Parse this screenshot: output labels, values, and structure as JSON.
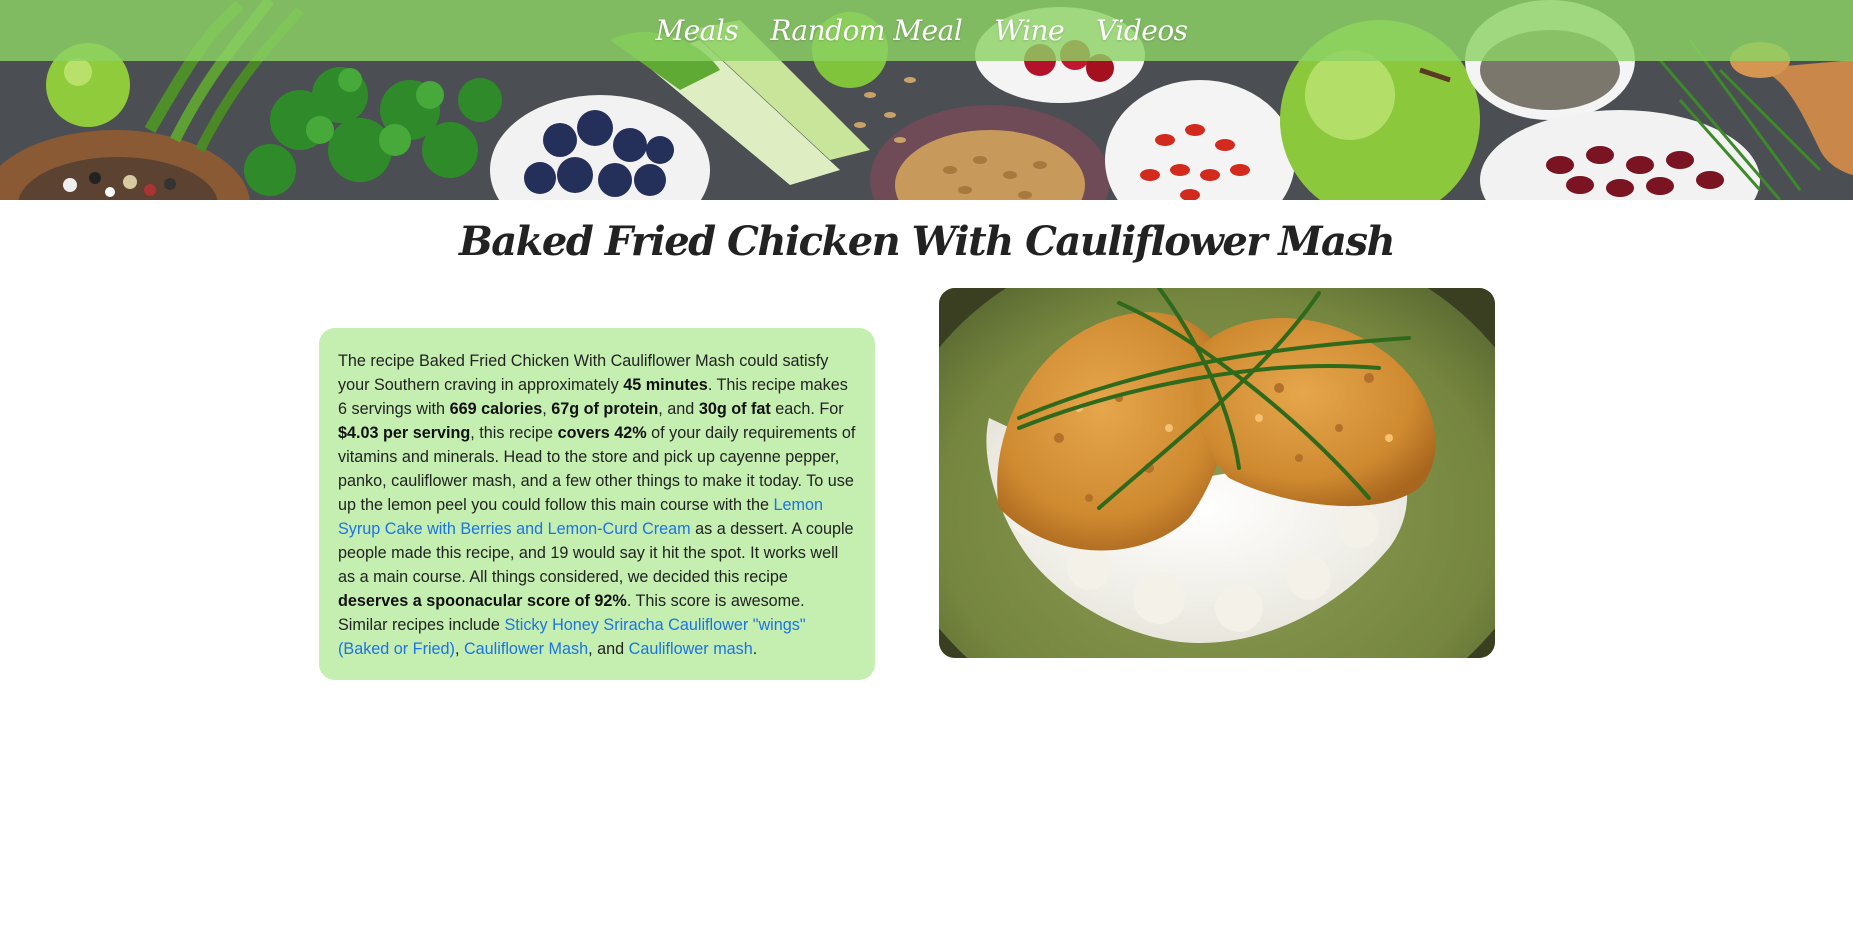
{
  "nav": {
    "items": [
      "Meals",
      "Random Meal",
      "Wine",
      "Videos"
    ]
  },
  "recipe": {
    "title": "Baked Fried Chicken With Cauliflower Mash",
    "summary": {
      "t1": "The recipe Baked Fried Chicken With Cauliflower Mash could satisfy your Southern craving in approximately ",
      "b1": "45 minutes",
      "t2": ". This recipe makes 6 servings with ",
      "b2": "669 calories",
      "t3": ", ",
      "b3": "67g of protein",
      "t4": ", and ",
      "b4": "30g of fat",
      "t5": " each. For ",
      "b5": "$4.03 per serving",
      "t6": ", this recipe ",
      "b6": "covers 42%",
      "t7": " of your daily requirements of vitamins and minerals. Head to the store and pick up cayenne pepper, panko, cauliflower mash, and a few other things to make it today. To use up the lemon peel you could follow this main course with the ",
      "l1": "Lemon Syrup Cake with Berries and Lemon-Curd Cream",
      "t8": " as a dessert. A couple people made this recipe, and 19 would say it hit the spot. It works well as a main course. All things considered, we decided this recipe ",
      "b7": "deserves a spoonacular score of 92%",
      "t9": ". This score is awesome. Similar recipes include ",
      "l2": "Sticky Honey Sriracha Cauliflower \"wings\" (Baked or Fried)",
      "t10": ", ",
      "l3": "Cauliflower Mash",
      "t11": ", and ",
      "l4": "Cauliflower mash",
      "t12": "."
    }
  },
  "colors": {
    "nav_bg": "#8cd264",
    "card_bg": "#c5eeb1",
    "link": "#1a73e8"
  },
  "icons": {
    "hero": "vegetables-banner-image",
    "food": "fried-chicken-photo"
  }
}
